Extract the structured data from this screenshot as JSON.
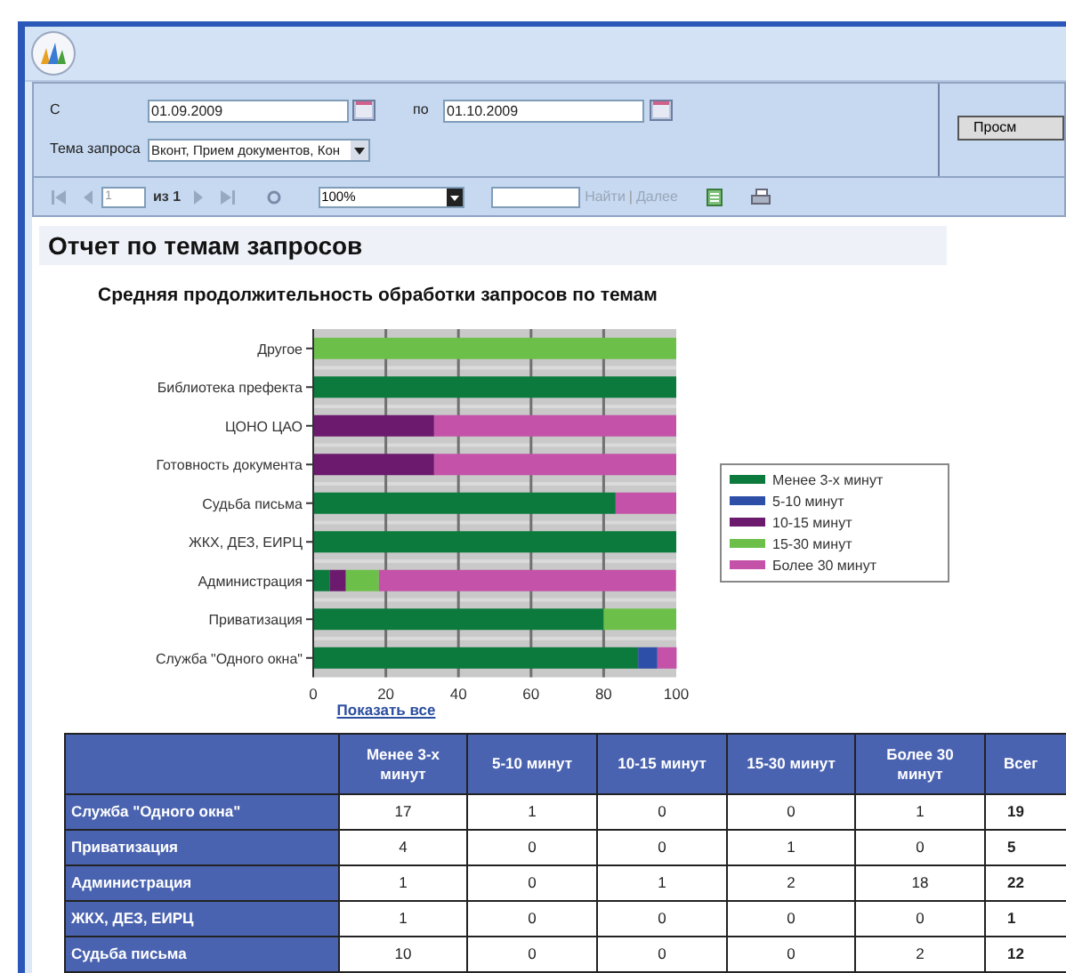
{
  "parameters": {
    "from_label": "С",
    "from_value": "01.09.2009",
    "to_label": "по",
    "to_value": "01.10.2009",
    "topic_label": "Тема запроса",
    "topic_value": "Вконт, Прием документов, Кон",
    "view_button": "Просм"
  },
  "toolbar": {
    "page_value": "1",
    "page_of": "из 1",
    "zoom": "100%",
    "search_links": [
      {
        "label": "Найти",
        "disabled": true
      },
      {
        "label": "Далее",
        "disabled": true
      }
    ],
    "search_separator": "|"
  },
  "report": {
    "title": "Отчет по темам запросов",
    "chart_title": "Средняя продолжительность обработки запросов по темам",
    "chart_data": {
      "type": "bar",
      "orientation": "horizontal",
      "stacked": true,
      "categories": [
        "Другое",
        "Библиотека префекта",
        "ЦОНО ЦАО",
        "Готовность документа",
        "Судьба письма",
        "ЖКХ, ДЕЗ, ЕИРЦ",
        "Администрация",
        "Приватизация",
        "Служба \"Одного окна\""
      ],
      "series": [
        {
          "name": "Менее 3-х минут",
          "color": "#0b7a3c",
          "values": [
            0,
            100,
            0,
            0,
            83.3,
            100,
            4.5,
            80,
            89.5
          ]
        },
        {
          "name": "5-10 минут",
          "color": "#2e4fa8",
          "values": [
            0,
            0,
            0,
            0,
            0,
            0,
            0,
            0,
            5.3
          ]
        },
        {
          "name": "10-15 минут",
          "color": "#6b1a6e",
          "values": [
            0,
            0,
            33.3,
            33.3,
            0,
            0,
            4.5,
            0,
            0
          ]
        },
        {
          "name": "15-30 минут",
          "color": "#6cc04a",
          "values": [
            100,
            0,
            0,
            0,
            0,
            0,
            9.1,
            20,
            0
          ]
        },
        {
          "name": "Более 30 минут",
          "color": "#c352a8",
          "values": [
            0,
            0,
            66.7,
            66.7,
            16.7,
            0,
            81.8,
            0,
            5.3
          ]
        }
      ],
      "xlim": [
        0,
        100
      ],
      "xticks": [
        0,
        20,
        40,
        60,
        80,
        100
      ],
      "grid": true,
      "legend": true
    },
    "show_all_link": "Показать все",
    "table": {
      "columns": [
        "Менее 3-х минут",
        "5-10 минут",
        "10-15 минут",
        "15-30 минут",
        "Более 30 минут",
        "Всег"
      ],
      "rows": [
        {
          "label": "Служба \"Одного окна\"",
          "cells": [
            "17",
            "1",
            "0",
            "0",
            "1",
            "19"
          ]
        },
        {
          "label": "Приватизация",
          "cells": [
            "4",
            "0",
            "0",
            "1",
            "0",
            "5"
          ]
        },
        {
          "label": "Администрация",
          "cells": [
            "1",
            "0",
            "1",
            "2",
            "18",
            "22"
          ]
        },
        {
          "label": "ЖКХ, ДЕЗ, ЕИРЦ",
          "cells": [
            "1",
            "0",
            "0",
            "0",
            "0",
            "1"
          ]
        },
        {
          "label": "Судьба письма",
          "cells": [
            "10",
            "0",
            "0",
            "0",
            "2",
            "12"
          ]
        }
      ]
    }
  }
}
